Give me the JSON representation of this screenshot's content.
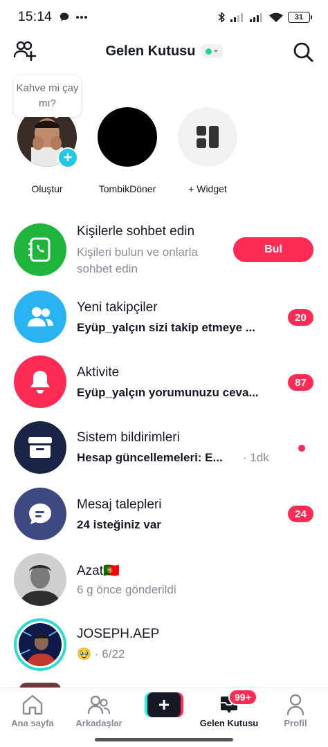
{
  "status_bar": {
    "time": "15:14",
    "battery": "31",
    "icons": [
      "message-bubble-icon",
      "more-dots-icon",
      "bluetooth-icon",
      "signal-icon",
      "signal-icon",
      "wifi-icon",
      "battery-icon"
    ]
  },
  "header": {
    "title": "Gelen Kutusu",
    "status_color": "#20d5a0",
    "add_friend_icon": "add-friends-icon",
    "search_icon": "search-icon"
  },
  "stories": {
    "tooltip": "Kahve mi çay mı?",
    "items": [
      {
        "label": "Oluştur"
      },
      {
        "label": "TombikDöner"
      },
      {
        "label": "+ Widget"
      }
    ]
  },
  "rows": [
    {
      "title": "Kişilerle sohbet edin",
      "subtitle_line1": "Kişileri bulun ve onlarla",
      "subtitle_line2": "sohbet edin",
      "button": "Bul",
      "icon": "contacts-icon",
      "color": "#1fb53d"
    },
    {
      "title": "Yeni takipçiler",
      "subtitle": "Eyüp_yalçın sizi takip etmeye ...",
      "badge": "20",
      "icon": "followers-icon",
      "color": "#2ab3f2"
    },
    {
      "title": "Aktivite",
      "subtitle": "Eyüp_yalçın yorumunuzu ceva...",
      "badge": "87",
      "icon": "bell-icon",
      "color": "#fe2c55"
    },
    {
      "title": "Sistem bildirimleri",
      "subtitle": "Hesap güncellemeleri: E...",
      "time": "· 1dk",
      "icon": "inbox-tray-icon",
      "color": "#1a2446"
    },
    {
      "title": "Mesaj talepleri",
      "subtitle": "24 isteğiniz var",
      "badge": "24",
      "icon": "chat-bubble-icon",
      "color": "#3d4a82"
    },
    {
      "title": "Azat🇵🇹",
      "subtitle": "6 g önce gönderildi",
      "avatar": "avatar-azat"
    },
    {
      "title": "JOSEPH.AEP",
      "subtitle_emoji": "🥹",
      "subtitle": "· 6/22",
      "avatar": "avatar-joseph"
    }
  ],
  "tabbar": {
    "tabs": [
      {
        "label": "Ana sayfa",
        "icon": "home-icon"
      },
      {
        "label": "Arkadaşlar",
        "icon": "friends-icon"
      },
      {
        "label": "",
        "icon": "plus-icon"
      },
      {
        "label": "Gelen Kutusu",
        "icon": "inbox-icon"
      },
      {
        "label": "Profil",
        "icon": "profile-icon"
      }
    ],
    "inbox_badge": "99+"
  }
}
